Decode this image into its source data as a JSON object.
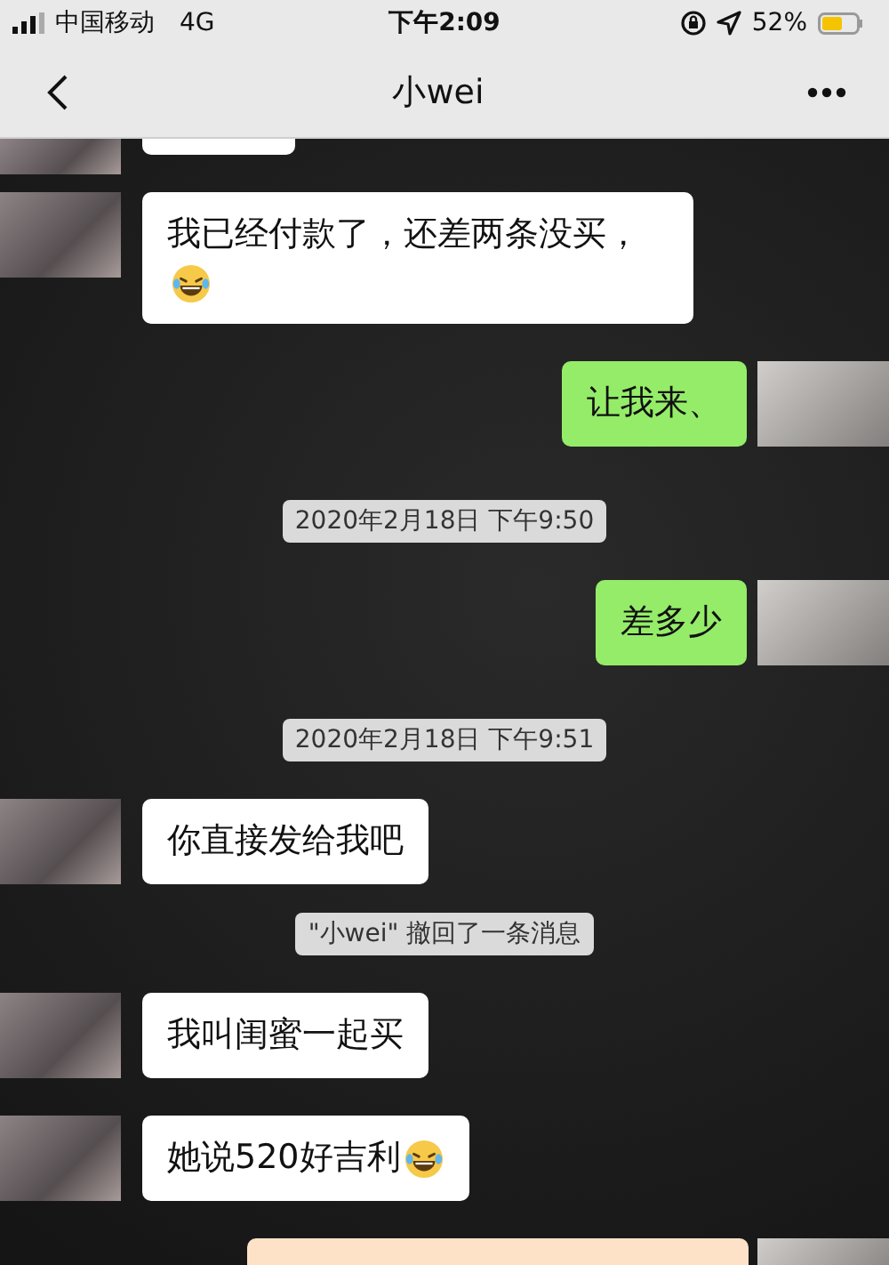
{
  "status_bar": {
    "carrier": "中国移动",
    "network": "4G",
    "time": "下午2:09",
    "battery": "52%"
  },
  "nav": {
    "title": "小wei"
  },
  "messages": [
    {
      "kind": "partial",
      "sent": false
    },
    {
      "kind": "message",
      "sent": false,
      "text": "我已经付款了，还差两条没买，",
      "emoji": true
    },
    {
      "kind": "message",
      "sent": true,
      "text": "让我来、",
      "emoji": false
    },
    {
      "kind": "time",
      "text": "2020年2月18日 下午9:50"
    },
    {
      "kind": "message",
      "sent": true,
      "text": "差多少",
      "emoji": false
    },
    {
      "kind": "time",
      "text": "2020年2月18日 下午9:51"
    },
    {
      "kind": "message",
      "sent": false,
      "text": "你直接发给我吧",
      "emoji": false
    },
    {
      "kind": "system",
      "text": "\"小wei\" 撤回了一条消息"
    },
    {
      "kind": "message",
      "sent": false,
      "text": "我叫闺蜜一起买",
      "emoji": false
    },
    {
      "kind": "message",
      "sent": false,
      "text": "她说520好吉利",
      "emoji": true
    },
    {
      "kind": "card",
      "sent": true
    }
  ]
}
